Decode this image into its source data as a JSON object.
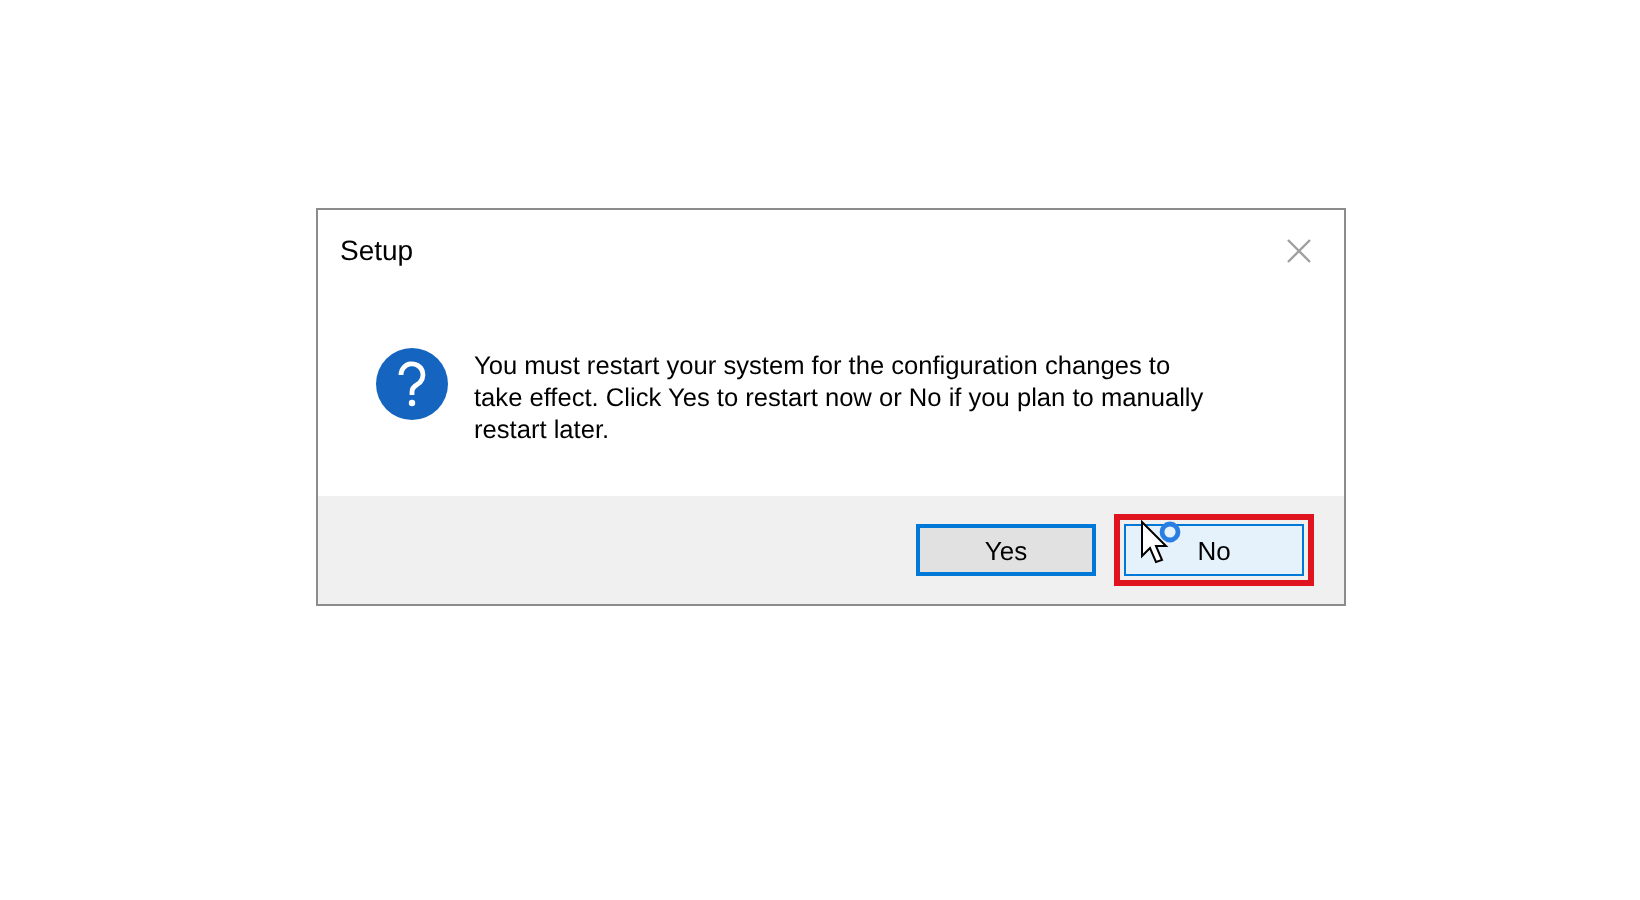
{
  "dialog": {
    "title": "Setup",
    "message": "You must restart your system for the configuration changes to take effect. Click Yes to restart now or No if you plan to manually restart later.",
    "buttons": [
      {
        "label": "Yes",
        "default": true,
        "hovered": false,
        "highlighted": false
      },
      {
        "label": "No",
        "default": false,
        "hovered": true,
        "highlighted": true
      }
    ]
  }
}
